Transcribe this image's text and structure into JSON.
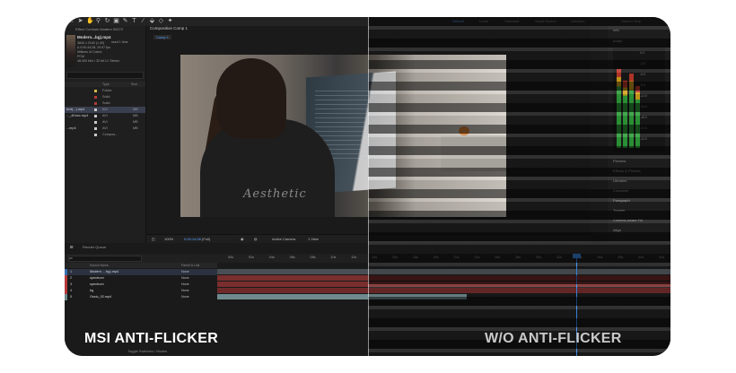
{
  "workspace_tabs": [
    "Default",
    "Learn",
    "Standard",
    "Small Screen",
    "Libraries"
  ],
  "search_help": "Search Help",
  "project": {
    "panel_title": "Effect Controls Modern 00272",
    "footage_name": "Modern...bg).mp4",
    "footage_used": "used 1 time",
    "meta": [
      "3840 x 2160 (1.00)",
      "Δ 0;00;44;28, 29.97 fps",
      "Millions of Colors",
      "PCM",
      "48.000 kHz / 32 bit U / Stereo"
    ],
    "columns": [
      "Type",
      "Size"
    ],
    "rows": [
      {
        "name": "",
        "type": "Folder",
        "size": "",
        "color": "#d4b84a"
      },
      {
        "name": "",
        "type": "Solid",
        "size": "",
        "color": "#b43a3a"
      },
      {
        "name": "",
        "type": "Solid",
        "size": "",
        "color": "#b43a3a"
      },
      {
        "name": "text(...).mp4",
        "type": "AVI",
        "size": "MB",
        "color": "#c9c9c9",
        "selected": true
      },
      {
        "name": "..._4Ksec.mp4",
        "type": "AVI",
        "size": "MB",
        "color": "#c9c9c9"
      },
      {
        "name": "",
        "type": "AVI",
        "size": "MB",
        "color": "#c9c9c9"
      },
      {
        "name": "...mp4",
        "type": "AVI",
        "size": "MB",
        "color": "#c9c9c9"
      },
      {
        "name": "",
        "type": "Compos...",
        "size": "",
        "color": "#c9c9c9"
      }
    ]
  },
  "composition": {
    "tab_label": "Composition Comp 1",
    "comp_label": "Comp 1",
    "jacket_text": "Aesthetic",
    "zoom": "100%",
    "timecode": "0;00;14;08",
    "resolution": "(Full)",
    "camera": "Active Camera",
    "views": "1 View"
  },
  "right_panels": {
    "info": "Info",
    "audio": "Audio",
    "db_ticks": [
      "0.0",
      "-3.0",
      "-6.0",
      "-9.0",
      "-12.0",
      "-15.0",
      "-18.0",
      "-21.0",
      "-24.0"
    ],
    "levels": [
      0.85,
      0.72,
      0.8,
      0.66
    ],
    "sections": [
      "Preview",
      "Effects & Presets",
      "Libraries",
      "Character",
      "Paragraph",
      "Tracker",
      "Content-Aware Fill",
      "Align"
    ]
  },
  "timeline": {
    "render_queue": "Render Queue",
    "search_placeholder": "ρ▾",
    "columns": [
      "Source Name",
      "Parent & Link"
    ],
    "ruler": [
      "00s",
      "02s",
      "04s",
      "06s",
      "08s",
      "10s",
      "12s",
      "14s",
      "16s",
      "18s",
      "20s",
      "22s",
      "24s",
      "26s",
      "28s",
      "30s",
      "32s",
      "34s",
      "36s",
      "38s",
      "40s",
      "42s"
    ],
    "toggle_label": "Toggle Switches / Modes",
    "layers": [
      {
        "num": "1",
        "name": "Modern ... bg).mp4",
        "parent": "None",
        "color": "#3a6fb0",
        "bar_color": "#4a4f55",
        "bar_end": 1.0,
        "selected": true
      },
      {
        "num": "2",
        "name": "spectrum",
        "parent": "None",
        "color": "#b43a3a",
        "bar_color": "#7a2e2e",
        "bar_end": 1.0
      },
      {
        "num": "3",
        "name": "spectrum",
        "parent": "None",
        "color": "#b43a3a",
        "bar_color": "#7a2e2e",
        "bar_end": 1.0
      },
      {
        "num": "4",
        "name": "bg",
        "parent": "None",
        "color": "#b43a3a",
        "bar_color": "#6e2a2a",
        "bar_end": 1.0
      },
      {
        "num": "5",
        "name": "Ossic_02.mp4",
        "parent": "None",
        "color": "#6a8a8a",
        "bar_color": "#6f8a8f",
        "bar_end": 0.55
      }
    ]
  },
  "captions": {
    "left": "MSI ANTI-FLICKER",
    "right": "W/O ANTI-FLICKER"
  }
}
